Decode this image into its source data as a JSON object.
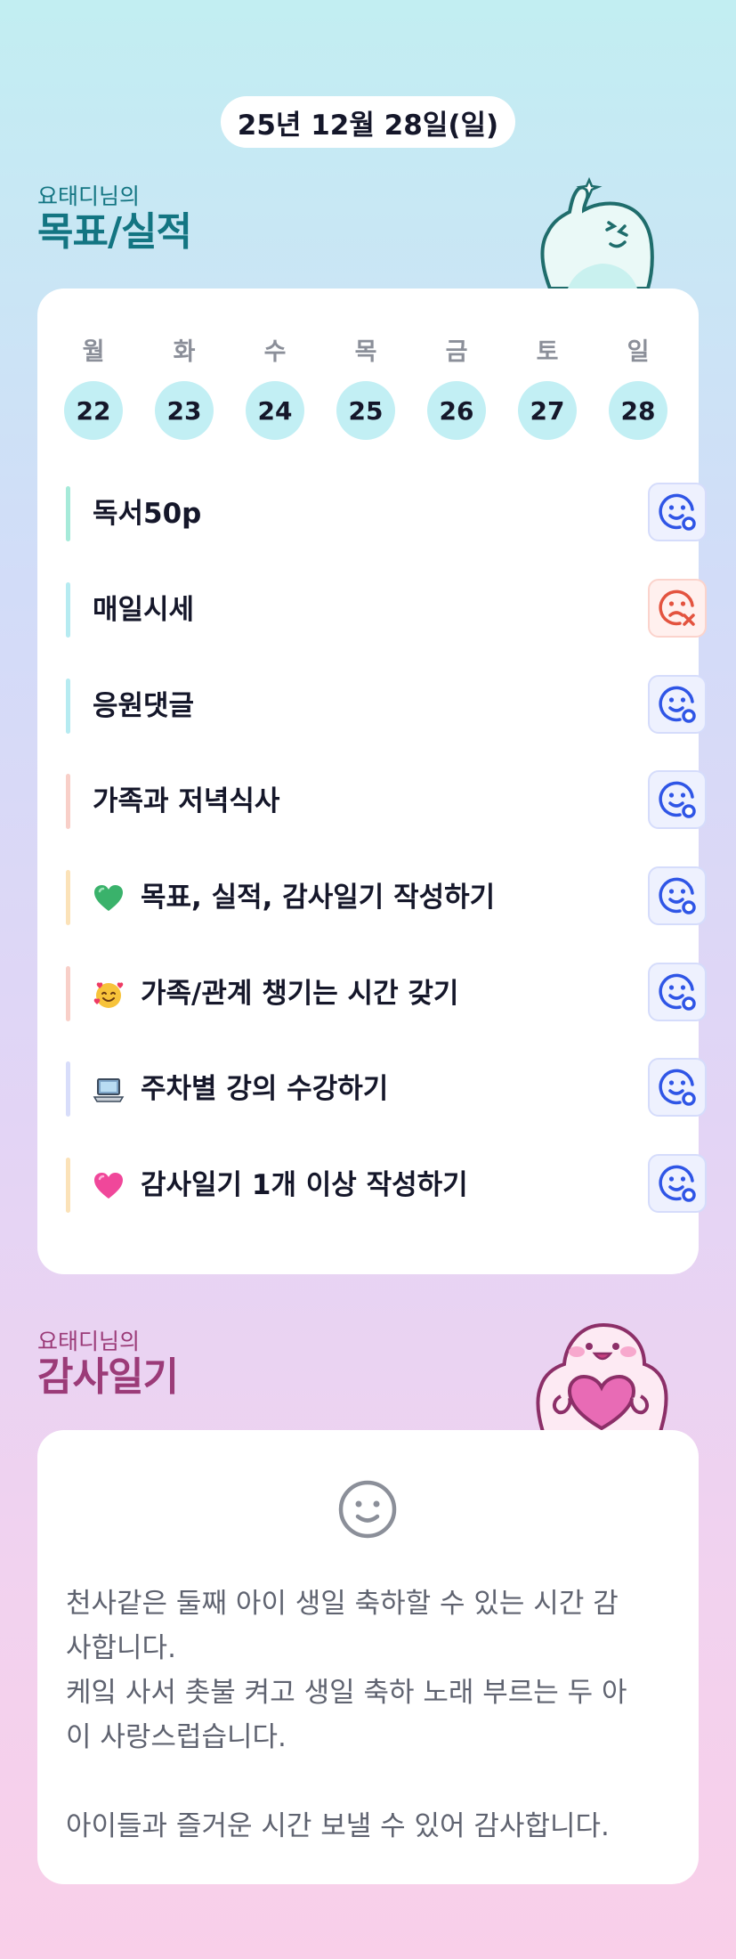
{
  "header": {
    "date": "25년 12월 28일(일)"
  },
  "goals_section": {
    "owner": "요태디님의",
    "title": "목표/실적",
    "week": [
      {
        "dow": "월",
        "day": "22"
      },
      {
        "dow": "화",
        "day": "23"
      },
      {
        "dow": "수",
        "day": "24"
      },
      {
        "dow": "목",
        "day": "25"
      },
      {
        "dow": "금",
        "day": "26"
      },
      {
        "dow": "토",
        "day": "27"
      },
      {
        "dow": "일",
        "day": "28"
      }
    ],
    "goals": [
      {
        "label": "독서50p",
        "bar_color": "#a6ead9",
        "status": "done",
        "emoji": ""
      },
      {
        "label": "매일시세",
        "bar_color": "#b6ebf1",
        "status": "failed",
        "emoji": ""
      },
      {
        "label": "응원댓글",
        "bar_color": "#b6ebf1",
        "status": "done",
        "emoji": ""
      },
      {
        "label": "가족과 저녁식사",
        "bar_color": "#f8cfc8",
        "status": "done",
        "emoji": ""
      },
      {
        "label": "목표, 실적, 감사일기 작성하기",
        "bar_color": "#fbe2b8",
        "status": "done",
        "emoji": "green-heart-icon"
      },
      {
        "label": "가족/관계 챙기는 시간 갖기",
        "bar_color": "#f8cfc8",
        "status": "done",
        "emoji": "smiling-face-with-hearts-icon"
      },
      {
        "label": "주차별 강의 수강하기",
        "bar_color": "#d8ddfa",
        "status": "done",
        "emoji": "laptop-icon"
      },
      {
        "label": "감사일기 1개 이상 작성하기",
        "bar_color": "#fbe2b8",
        "status": "done",
        "emoji": "pink-heart-icon"
      }
    ]
  },
  "thanks_section": {
    "owner": "요태디님의",
    "title": "감사일기",
    "mood_icon": "neutral-smile-icon",
    "diary_text": "천사같은 둘째 아이 생일 축하할 수 있는 시간 감\n사합니다.\n케잌 사서 촛불 켜고 생일 축하 노래 부르는 두 아\n이 사랑스럽습니다.\n\n아이들과 즐거운 시간 보낼 수 있어 감사합니다."
  },
  "colors": {
    "accent_teal": "#137582",
    "accent_plum": "#9b3b78",
    "status_ok": "#2f55e6",
    "status_fail": "#e3533f",
    "day_circle": "#c2eff4"
  }
}
